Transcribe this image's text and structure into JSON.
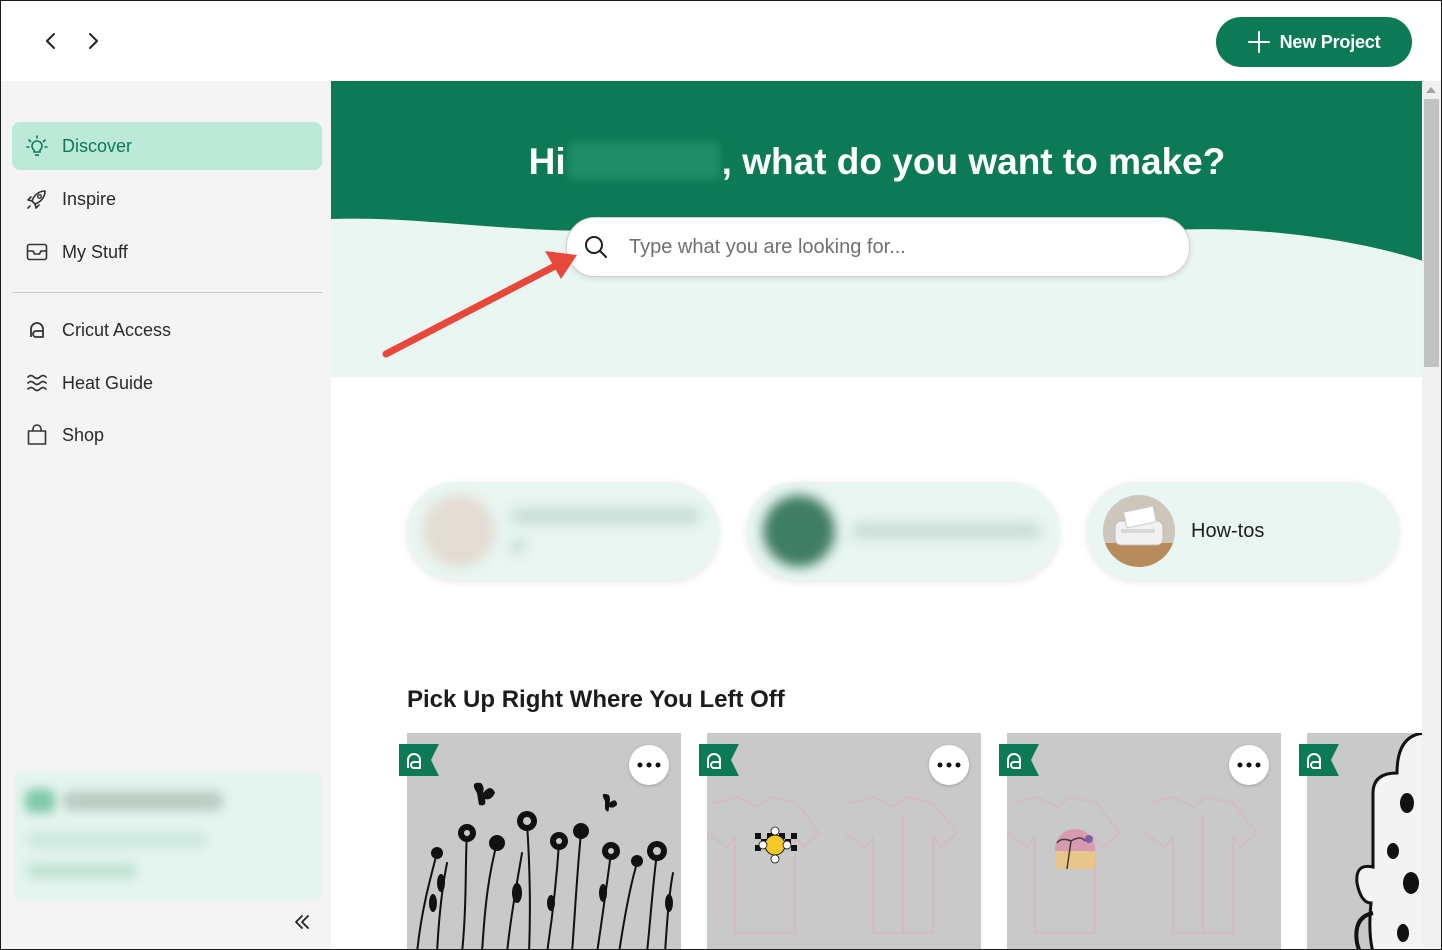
{
  "topbar": {
    "back_icon": "chevron-left-icon",
    "forward_icon": "chevron-right-icon",
    "new_project_label": "New Project",
    "accent": "#0c7a56"
  },
  "sidebar": {
    "items": [
      {
        "label": "Discover",
        "icon": "lightbulb-icon",
        "active": true
      },
      {
        "label": "Inspire",
        "icon": "rocket-icon"
      },
      {
        "label": "My Stuff",
        "icon": "inbox-icon"
      },
      {
        "label": "Cricut Access",
        "icon": "cricut-access-icon"
      },
      {
        "label": "Heat Guide",
        "icon": "heat-waves-icon"
      },
      {
        "label": "Shop",
        "icon": "shopping-bag-icon"
      }
    ],
    "collapse_icon": "double-chevron-left-icon"
  },
  "hero": {
    "greeting": "Hi",
    "question": ", what do you want to make?",
    "search_placeholder": "Type what you are looking for...",
    "colors": {
      "green": "#0c7a56",
      "light": "#e9f6f1"
    }
  },
  "pills": [
    {
      "label": "",
      "blurred": true
    },
    {
      "label": "",
      "blurred": true
    },
    {
      "label": "How-tos",
      "blurred": false
    }
  ],
  "section": {
    "title": "Pick Up Right Where You Left Off"
  },
  "cards": [
    {
      "name": "wildflowers-design"
    },
    {
      "name": "tshirt-smiley-design"
    },
    {
      "name": "tshirt-palm-design"
    },
    {
      "name": "cactus-design"
    }
  ]
}
